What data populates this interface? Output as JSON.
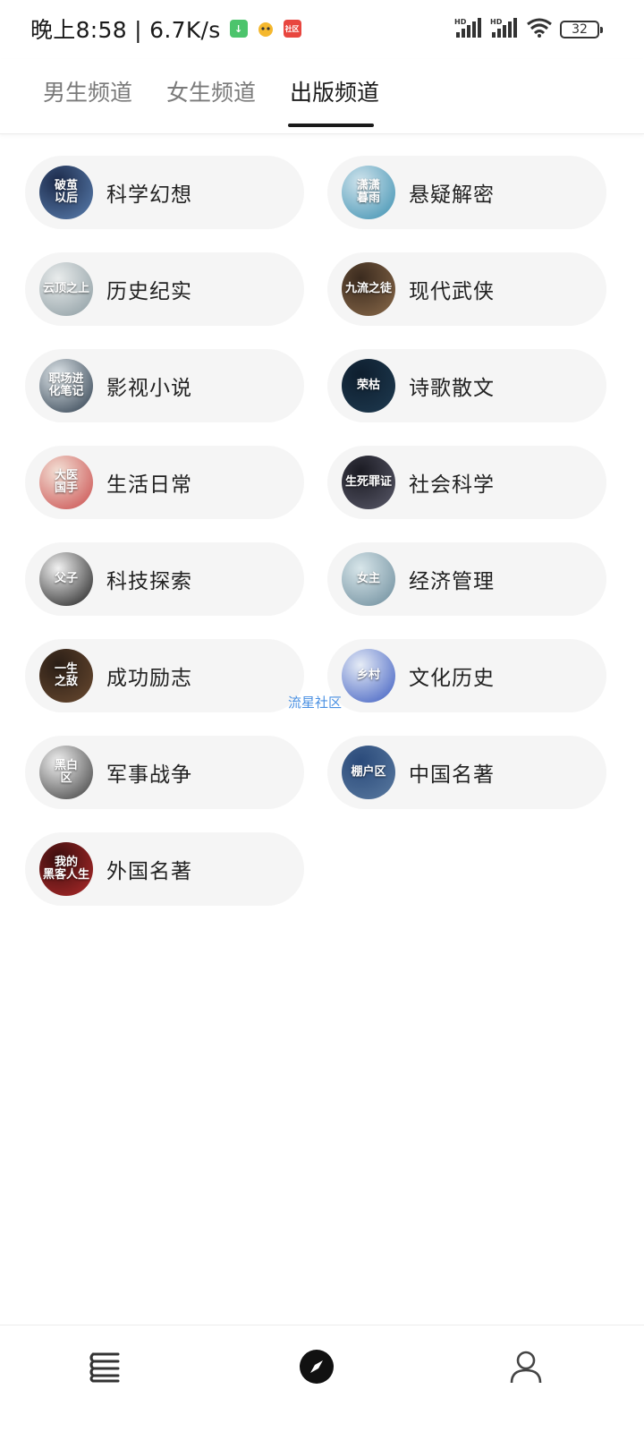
{
  "status_bar": {
    "time_speed": "晚上8:58 | 6.7K/s",
    "notif_red_text": "社区",
    "signal_label_1": "HD",
    "signal_label_2": "HD",
    "battery": "32"
  },
  "tabs": [
    {
      "label": "男生频道",
      "active": false
    },
    {
      "label": "女生频道",
      "active": false
    },
    {
      "label": "出版频道",
      "active": true
    }
  ],
  "categories": [
    {
      "label": "科学幻想",
      "cover_text": "破茧\n以后",
      "cover_colors": [
        "#1c2a4a",
        "#5a7fb0"
      ]
    },
    {
      "label": "悬疑解密",
      "cover_text": "潇潇\n暮雨",
      "cover_colors": [
        "#cfe3ec",
        "#3b8fb0"
      ]
    },
    {
      "label": "历史纪实",
      "cover_text": "云顶之上",
      "cover_colors": [
        "#e9ecec",
        "#8a9aa0"
      ]
    },
    {
      "label": "现代武侠",
      "cover_text": "九流之徒",
      "cover_colors": [
        "#3a2a1e",
        "#8a6a4a"
      ]
    },
    {
      "label": "影视小说",
      "cover_text": "职场进\n化笔记",
      "cover_colors": [
        "#dfe6ea",
        "#2a3a4a"
      ]
    },
    {
      "label": "诗歌散文",
      "cover_text": "荣枯",
      "cover_colors": [
        "#0e1e2e",
        "#1e3a50"
      ]
    },
    {
      "label": "生活日常",
      "cover_text": "大医\n国手",
      "cover_colors": [
        "#f3e1d6",
        "#c94a4a"
      ]
    },
    {
      "label": "社会科学",
      "cover_text": "生死罪证",
      "cover_colors": [
        "#1a1a22",
        "#5a5a6a"
      ]
    },
    {
      "label": "科技探索",
      "cover_text": "父子",
      "cover_colors": [
        "#f2f2f2",
        "#1a1a1a"
      ]
    },
    {
      "label": "经济管理",
      "cover_text": "女主",
      "cover_colors": [
        "#d8e6ea",
        "#6a8a9a"
      ]
    },
    {
      "label": "成功励志",
      "cover_text": "一生\n之敌",
      "cover_colors": [
        "#2a1e16",
        "#6a4a30"
      ]
    },
    {
      "label": "文化历史",
      "cover_text": "乡村",
      "cover_colors": [
        "#e6ecf6",
        "#3a5ac0"
      ]
    },
    {
      "label": "军事战争",
      "cover_text": "黑白\n区",
      "cover_colors": [
        "#f0f0f0",
        "#3a3a3a"
      ]
    },
    {
      "label": "中国名著",
      "cover_text": "棚户区",
      "cover_colors": [
        "#2a4a7a",
        "#5a7aa0"
      ]
    },
    {
      "label": "外国名著",
      "cover_text": "我的\n黑客人生",
      "cover_colors": [
        "#3a0e0e",
        "#b02a2a"
      ]
    }
  ],
  "watermark": "流星社区",
  "bottom_nav": [
    {
      "icon": "bookshelf-icon",
      "active": false
    },
    {
      "icon": "compass-icon",
      "active": true
    },
    {
      "icon": "user-icon",
      "active": false
    }
  ]
}
